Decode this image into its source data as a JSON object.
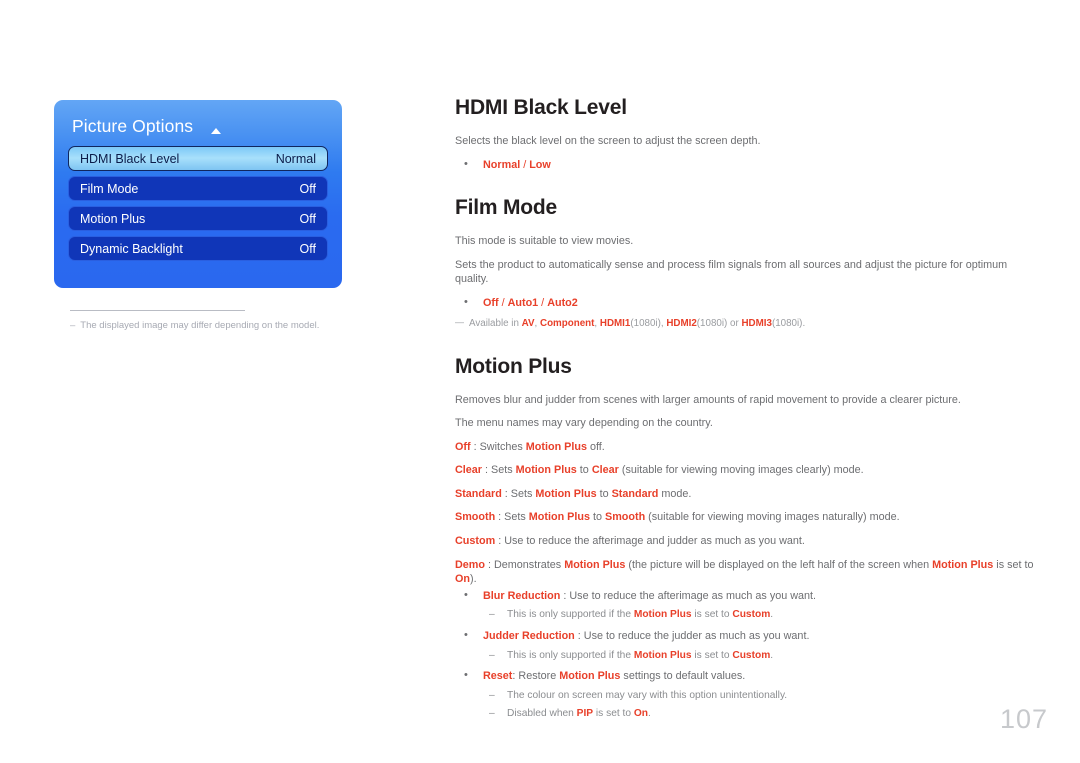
{
  "page": {
    "number": "107"
  },
  "osd": {
    "title": "Picture Options",
    "scroll_icon": "triangle-up-icon",
    "rows": [
      {
        "label": "HDMI Black Level",
        "value": "Normal",
        "selected": true
      },
      {
        "label": "Film Mode",
        "value": "Off",
        "selected": false
      },
      {
        "label": "Motion Plus",
        "value": "Off",
        "selected": false
      },
      {
        "label": "Dynamic Backlight",
        "value": "Off",
        "selected": false
      }
    ],
    "note": {
      "dash": "–",
      "text": "The displayed image may differ depending on the model."
    }
  },
  "colors": {
    "accent": "#e8402a",
    "body_text": "#6d6e71",
    "heading": "#231f20",
    "osd_blue_top": "#63a6f5",
    "osd_blue_bottom": "#2a68ef",
    "osd_row_navy": "#1036b8",
    "page_number": "#c7c9cc"
  },
  "sections": {
    "hdmi_black_level": {
      "title": "HDMI Black Level",
      "description": "Selects the black level on the screen to adjust the screen depth.",
      "options": {
        "a": "Normal",
        "sep": " / ",
        "b": "Low"
      }
    },
    "film_mode": {
      "title": "Film Mode",
      "p1": "This mode is suitable to view movies.",
      "p2": "Sets the product to automatically sense and process film signals from all sources and adjust the picture for optimum quality.",
      "options": {
        "a": "Off",
        "sep1": " / ",
        "b": "Auto1",
        "sep2": " / ",
        "c": "Auto2"
      },
      "availability": {
        "prefix": "Available in ",
        "src1": "AV",
        "c1": ", ",
        "src2": "Component",
        "c2": ", ",
        "src3": "HDMI1",
        "q3": "(1080i)",
        "c3": ", ",
        "src4": "HDMI2",
        "q4": "(1080i)",
        "c4": " or ",
        "src5": "HDMI3",
        "q5": "(1080i)",
        "end": "."
      }
    },
    "motion_plus": {
      "title": "Motion Plus",
      "p1": "Removes blur and judder from scenes with larger amounts of rapid movement to provide a clearer picture.",
      "p2": "The menu names may vary depending on the country.",
      "modes": [
        {
          "name": "Off",
          "sep": " : Switches ",
          "ref": "Motion Plus",
          "tail": " off."
        },
        {
          "name": "Clear",
          "sep": " : Sets ",
          "ref": "Motion Plus",
          "mid": " to ",
          "target": "Clear",
          "tail": " (suitable for viewing moving images clearly) mode."
        },
        {
          "name": "Standard",
          "sep": " : Sets ",
          "ref": "Motion Plus",
          "mid": " to ",
          "target": "Standard",
          "tail": " mode."
        },
        {
          "name": "Smooth",
          "sep": " : Sets ",
          "ref": "Motion Plus",
          "mid": " to ",
          "target": "Smooth",
          "tail": " (suitable for viewing moving images naturally) mode."
        },
        {
          "name": "Custom",
          "sep": " : Use to reduce the afterimage and judder as much as you want."
        },
        {
          "name": "Demo",
          "sep": " : Demonstrates ",
          "ref": "Motion Plus",
          "mid": " (the picture will be displayed on the left half of the screen when ",
          "ref2": "Motion Plus",
          "mid2": " is set to ",
          "target": "On",
          "tail": ")."
        }
      ],
      "bullets": [
        {
          "name": "Blur Reduction",
          "text": " : Use to reduce the afterimage as much as you want.",
          "subs": [
            {
              "pre": "This is only supported if the ",
              "ref": "Motion Plus",
              "mid": " is set to ",
              "target": "Custom",
              "post": "."
            }
          ]
        },
        {
          "name": "Judder Reduction",
          "text": " : Use to reduce the judder as much as you want.",
          "subs": [
            {
              "pre": "This is only supported if the ",
              "ref": "Motion Plus",
              "mid": " is set to ",
              "target": "Custom",
              "post": "."
            }
          ]
        },
        {
          "name": "Reset",
          "text_pre": ": Restore ",
          "ref": "Motion Plus",
          "text_post": " settings to default values.",
          "subs": [
            {
              "plain": "The colour on screen may vary with this option unintentionally."
            },
            {
              "pre": "Disabled when ",
              "ref": "PIP",
              "mid": " is set to ",
              "target": "On",
              "post": "."
            }
          ]
        }
      ]
    }
  }
}
